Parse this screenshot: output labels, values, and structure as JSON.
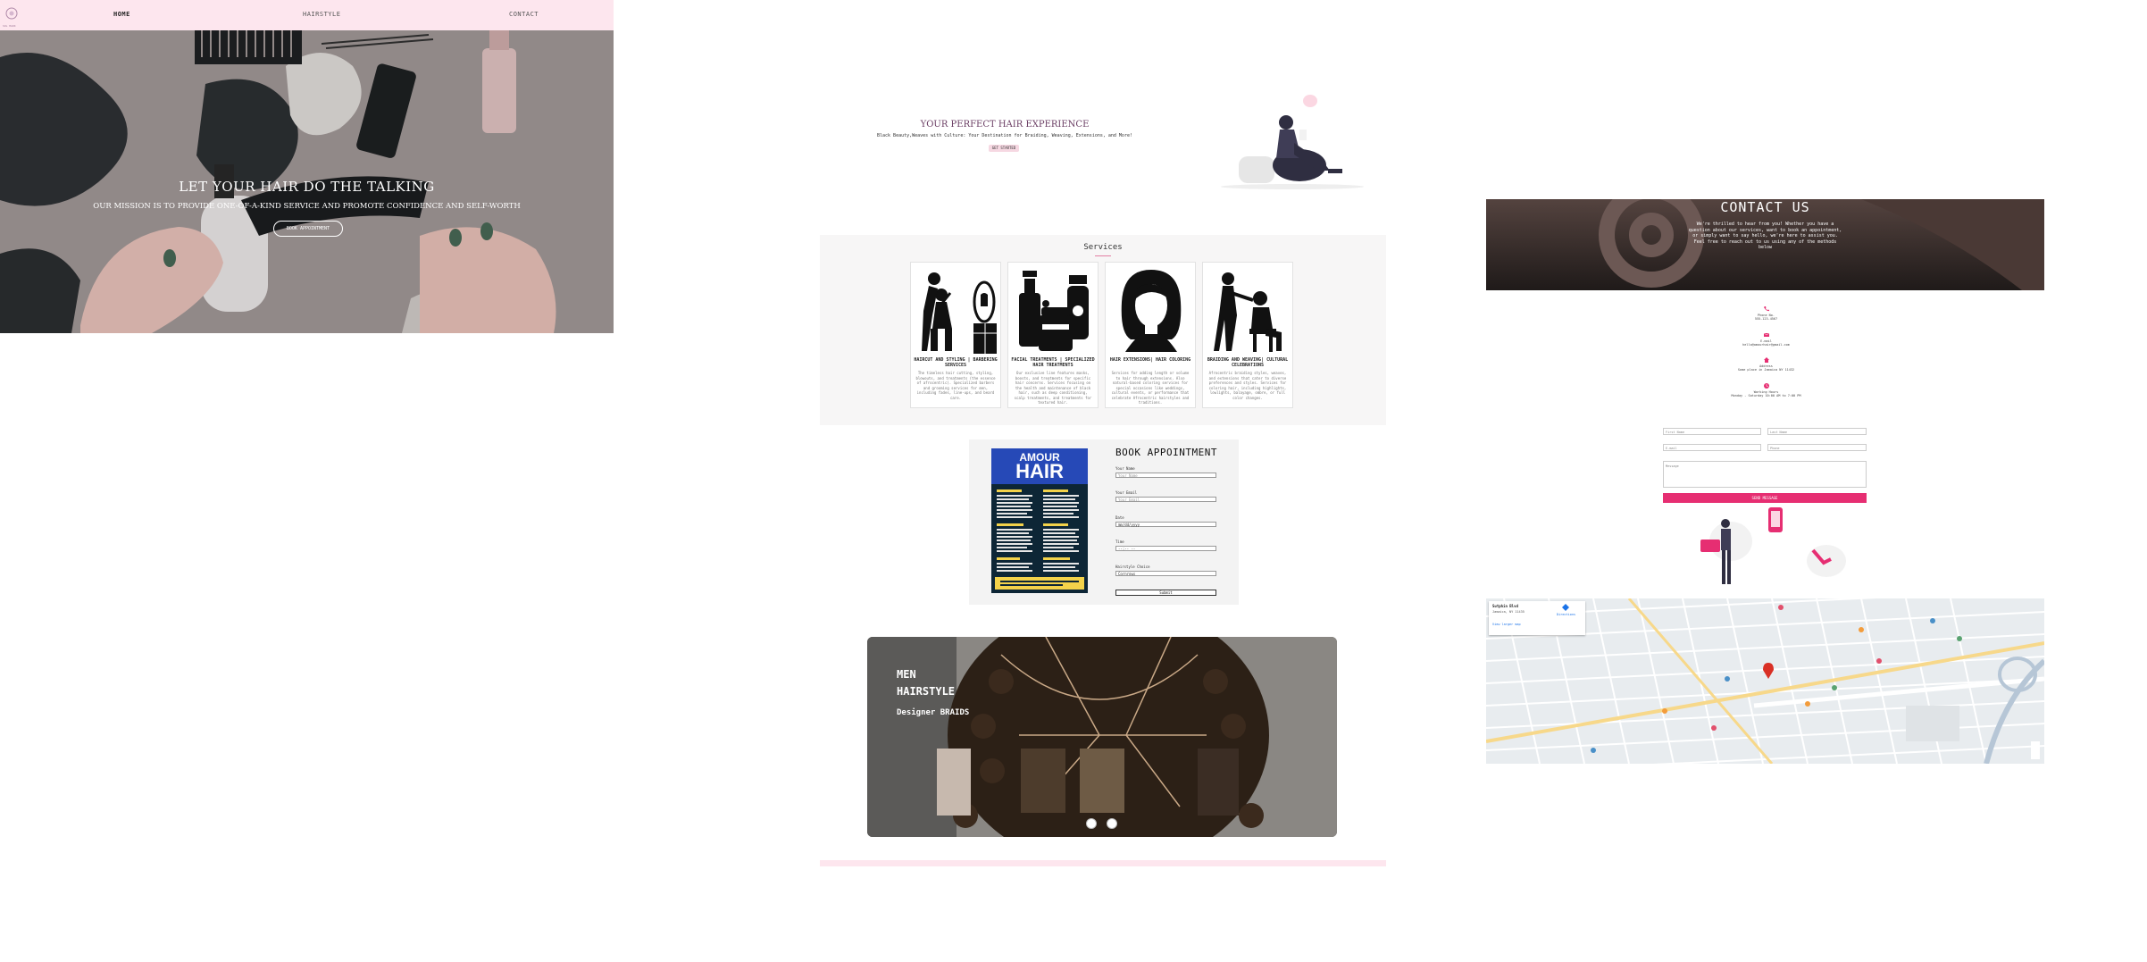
{
  "home": {
    "logo_text": "SOL HAIR",
    "nav": [
      "HOME",
      "HAIRSTYLE",
      "CONTACT"
    ],
    "hero_title": "LET YOUR HAIR DO THE TALKING",
    "hero_subtitle": "OUR MISSION IS TO PROVIDE ONE-OF-A-KIND SERVICE AND PROMOTE CONFIDENCE AND SELF-WORTH",
    "hero_button": "BOOK APPOINTMENT"
  },
  "experience": {
    "title": "YOUR PERFECT HAIR EXPERIENCE",
    "subtitle": "Black Beauty,Weaves with Culture: Your Destination for Braiding, Weaving, Extensions, and More!",
    "button": "GET STARTED"
  },
  "services": {
    "heading": "Services",
    "cards": [
      {
        "title": "HAIRCUT AND STYLING | BARBERING SERVICES",
        "desc": "The timeless hair cutting, styling, blowouts, and treatments (the essence of afrocentric). Specialized barbers and grooming services for men, including fades, line-ups, and beard care."
      },
      {
        "title": "FACIAL TREATMENTS | SPECIALIZED HAIR TREATMENTS",
        "desc": "Our exclusive line features masks, boosts, and treatments for specific hair concerns. Services focusing on the health and maintenance of black hair, such as deep conditioning, scalp treatments, and treatments for textured hair."
      },
      {
        "title": "HAIR EXTENSIONS| HAIR COLORING",
        "desc": "Services for adding length or volume to hair through extensions. Also natural-based coloring services for special occasions like weddings, cultural events, or performance that celebrate Afrocentric hairstyles and traditions."
      },
      {
        "title": "BRAIDING AND WEAVING| CULTURAL CELEBRATIONS",
        "desc": "Afrocentric braiding styles, weaves, and extensions that cater to diverse preferences and styles. Services for coloring hair, including highlights, lowlights, balayage, ombre, or full color changes."
      }
    ]
  },
  "booking": {
    "flyer_line1": "AMOUR",
    "flyer_line2": "HAIR",
    "title": "BOOK APPOINTMENT",
    "fields": [
      {
        "label": "Your Name",
        "placeholder": "Your Name"
      },
      {
        "label": "Your Email",
        "placeholder": "Your Email"
      },
      {
        "label": "Date",
        "placeholder": "mm/dd/yyyy"
      },
      {
        "label": "Time",
        "placeholder": "--:-- --"
      },
      {
        "label": "Hairstyle Choice",
        "placeholder": "Cornrows"
      }
    ],
    "submit": "Submit"
  },
  "slider": {
    "line1": "MEN",
    "line2": "HAIRSTYLE",
    "line3": "Designer BRAIDS"
  },
  "contact": {
    "title": "CONTACT US",
    "text": "We're thrilled to hear from you! Whether you have a question about our services, want to book an appointment, or simply want to say hello, we're here to assist you. Feel free to reach out to us using any of the methods below",
    "items": [
      {
        "label": "Phone No.",
        "value": "555-123-4567"
      },
      {
        "label": "E-mail",
        "value": "hello@amourhair@gmail.com"
      },
      {
        "label": "Address",
        "value": "Some place in Jamaica NY 11432"
      },
      {
        "label": "Working Hours",
        "value": "Monday - Saturday 10:00 AM to 7:00 PM"
      }
    ],
    "form": {
      "first_name": "First Name",
      "last_name": "Last Name",
      "email": "E-mail",
      "phone": "Phone",
      "message": "Message",
      "send": "SEND MESSAGE"
    },
    "map": {
      "place": "Sutphin Blvd",
      "address": "Jamaica, NY 11435",
      "link": "View larger map",
      "directions": "Directions"
    }
  }
}
